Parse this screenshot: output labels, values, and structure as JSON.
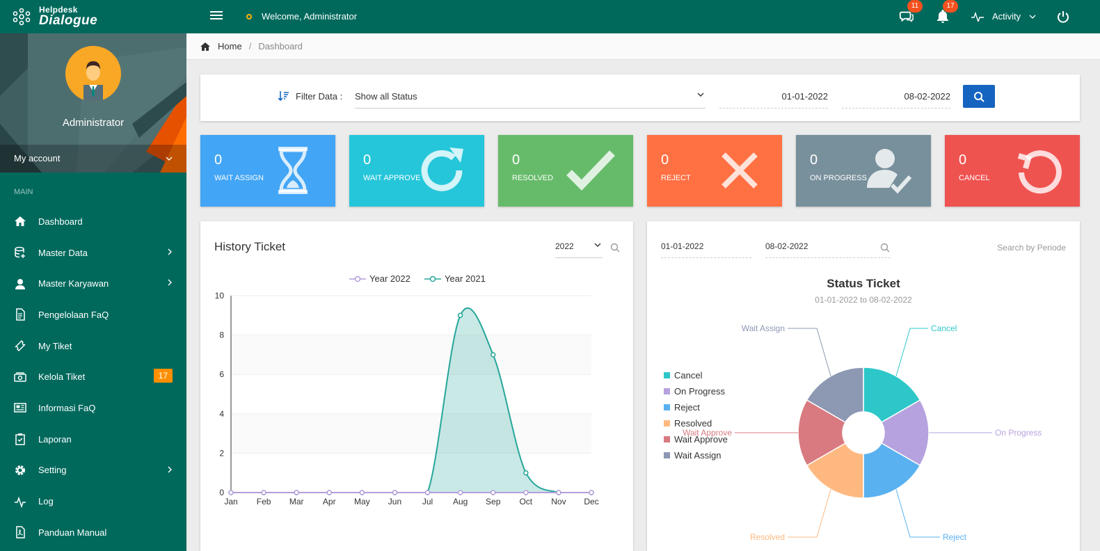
{
  "topbar": {
    "brand_small": "Helpdesk",
    "brand_big": "Dialogue",
    "welcome": "Welcome, Administrator",
    "chat_badge": "11",
    "notif_badge": "17",
    "activity_label": "Activity"
  },
  "sidebar": {
    "profile_name": "Administrator",
    "my_account": "My account",
    "section": "MAIN",
    "items": [
      {
        "label": "Dashboard",
        "icon": "home-icon"
      },
      {
        "label": "Master Data",
        "icon": "database-icon",
        "has_sub": true
      },
      {
        "label": "Master Karyawan",
        "icon": "user-icon",
        "has_sub": true
      },
      {
        "label": "Pengelolaan FaQ",
        "icon": "document-icon"
      },
      {
        "label": "My Tiket",
        "icon": "ticket-icon"
      },
      {
        "label": "Kelola Tiket",
        "icon": "money-icon",
        "badge": "17"
      },
      {
        "label": "Informasi FaQ",
        "icon": "newspaper-icon"
      },
      {
        "label": "Laporan",
        "icon": "clipboard-icon"
      },
      {
        "label": "Setting",
        "icon": "gear-icon",
        "has_sub": true
      },
      {
        "label": "Log",
        "icon": "pulse-icon"
      },
      {
        "label": "Panduan Manual",
        "icon": "pdf-icon"
      }
    ]
  },
  "breadcrumb": {
    "home": "Home",
    "current": "Dashboard"
  },
  "filter": {
    "label": "Filter Data :",
    "status_value": "Show all Status",
    "date_from": "01-01-2022",
    "date_to": "08-02-2022"
  },
  "tiles": [
    {
      "value": "0",
      "label": "WAIT ASSIGN",
      "color": "#42a5f5",
      "icon": "hourglass-icon"
    },
    {
      "value": "0",
      "label": "WAIT APPROVE",
      "color": "#26c6da",
      "icon": "refresh-icon"
    },
    {
      "value": "0",
      "label": "RESOLVED",
      "color": "#66bb6a",
      "icon": "check-icon"
    },
    {
      "value": "0",
      "label": "REJECT",
      "color": "#ff7043",
      "icon": "close-icon"
    },
    {
      "value": "0",
      "label": "ON PROGRESS",
      "color": "#78909c",
      "icon": "user-check-icon"
    },
    {
      "value": "0",
      "label": "CANCEL",
      "color": "#ef5350",
      "icon": "undo-icon"
    }
  ],
  "history": {
    "title": "History Ticket",
    "year_value": "2022"
  },
  "status": {
    "date_from": "01-01-2022",
    "date_to": "08-02-2022",
    "search_label": "Search by Periode",
    "title": "Status Ticket",
    "subtitle": "01-01-2022 to 08-02-2022"
  },
  "chart_data": [
    {
      "type": "area",
      "title": "History Ticket",
      "categories": [
        "Jan",
        "Feb",
        "Mar",
        "Apr",
        "May",
        "Jun",
        "Jul",
        "Aug",
        "Sep",
        "Oct",
        "Nov",
        "Dec"
      ],
      "series": [
        {
          "name": "Year 2022",
          "color": "#b39ddb",
          "values": [
            0,
            0,
            0,
            0,
            0,
            0,
            0,
            0,
            0,
            0,
            0,
            0
          ]
        },
        {
          "name": "Year 2021",
          "color": "#26a69a",
          "values": [
            0,
            0,
            0,
            0,
            0,
            0,
            0,
            9,
            7,
            1,
            0,
            0
          ]
        }
      ],
      "ylim": [
        0,
        10
      ],
      "yticks": [
        0,
        2,
        4,
        6,
        8,
        10
      ],
      "legend": "top"
    },
    {
      "type": "pie",
      "title": "Status Ticket",
      "subtitle": "01-01-2022 to 08-02-2022",
      "slices": [
        {
          "label": "Cancel",
          "value": 1,
          "color": "#2ec7c9"
        },
        {
          "label": "On Progress",
          "value": 1,
          "color": "#b6a2de"
        },
        {
          "label": "Reject",
          "value": 1,
          "color": "#5ab1ef"
        },
        {
          "label": "Resolved",
          "value": 1,
          "color": "#ffb980"
        },
        {
          "label": "Wait Approve",
          "value": 1,
          "color": "#d87a80"
        },
        {
          "label": "Wait Assign",
          "value": 1,
          "color": "#8d98b3"
        }
      ],
      "legend": "left"
    }
  ]
}
